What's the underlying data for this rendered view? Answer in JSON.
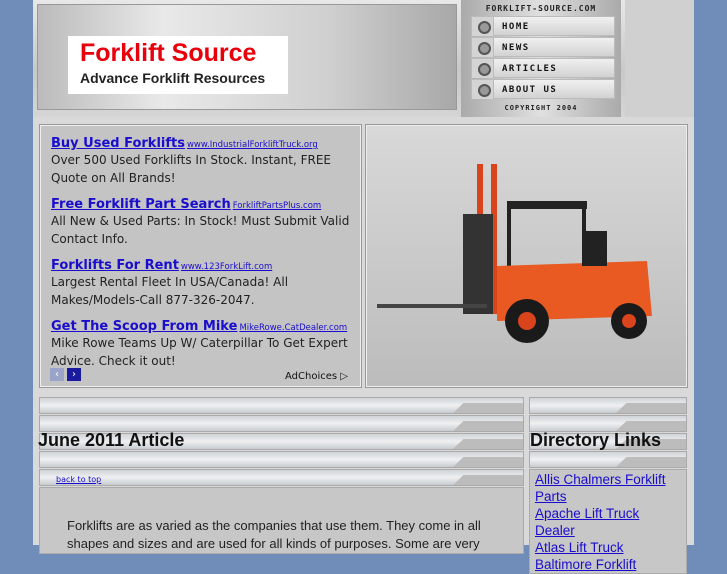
{
  "header": {
    "site_title": "Forklift Source",
    "tagline": "Advance Forklift Resources",
    "domain": "forklift-source.com",
    "copyright": "Copyright 2004"
  },
  "nav": [
    {
      "label": "Home"
    },
    {
      "label": "News"
    },
    {
      "label": "Articles"
    },
    {
      "label": "About Us"
    }
  ],
  "ads": [
    {
      "title": "Buy Used Forklifts",
      "url": "www.IndustrialForkliftTruck.org",
      "text": "Over 500 Used Forklifts In Stock. Instant, FREE Quote on All Brands!"
    },
    {
      "title": "Free Forklift Part Search",
      "url": "ForkliftPartsPlus.com",
      "text": "All New & Used Parts: In Stock! Must Submit Valid Contact Info."
    },
    {
      "title": "Forklifts For Rent",
      "url": "www.123ForkLift.com",
      "text": "Largest Rental Fleet In USA/Canada! All Makes/Models-Call 877-326-2047."
    },
    {
      "title": "Get The Scoop From Mike",
      "url": "MikeRowe.CatDealer.com",
      "text": "Mike Rowe Teams Up W/ Caterpillar To Get Expert Advice. Check it out!"
    }
  ],
  "ad_choices": "AdChoices",
  "ad_prev": "‹",
  "ad_next": "›",
  "article": {
    "title": "June 2011 Article",
    "back_to_top": "back to top",
    "text": "Forklifts are as varied as the companies that use them. They come in all shapes and sizes and are used for all kinds of purposes. Some are very"
  },
  "directory": {
    "title": "Directory Links",
    "links": [
      "Allis Chalmers Forklift Parts",
      "Apache Lift Truck Dealer",
      "Atlas Lift Truck",
      "Baltimore Forklift"
    ]
  }
}
